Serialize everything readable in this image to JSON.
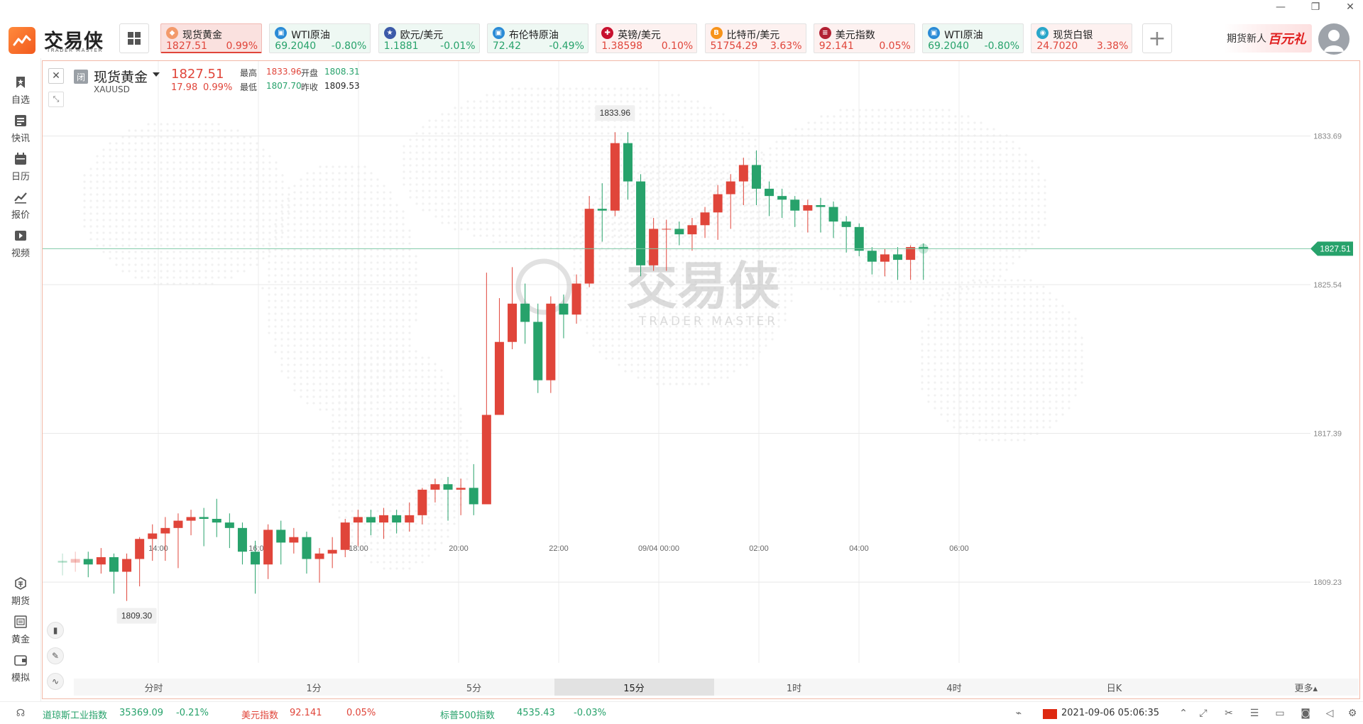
{
  "app": {
    "brand": "交易侠",
    "brand_sub": "TRADER MASTER"
  },
  "window": {
    "minimize": "—",
    "restore": "❐",
    "close": "✕"
  },
  "quotes": [
    {
      "name": "现货黄金",
      "price": "1827.51",
      "pct": "0.99%",
      "dir": "up",
      "icon_color": "#f39a6b",
      "icon_char": "◆",
      "active": true
    },
    {
      "name": "WTI原油",
      "price": "69.2040",
      "pct": "-0.80%",
      "dir": "down",
      "icon_color": "#2a8bd6",
      "icon_char": "▣",
      "active": false
    },
    {
      "name": "欧元/美元",
      "price": "1.1881",
      "pct": "-0.01%",
      "dir": "down",
      "icon_color": "#3c5aa8",
      "icon_char": "★",
      "active": false
    },
    {
      "name": "布伦特原油",
      "price": "72.42",
      "pct": "-0.49%",
      "dir": "down",
      "icon_color": "#2a8bd6",
      "icon_char": "▣",
      "active": false
    },
    {
      "name": "英镑/美元",
      "price": "1.38598",
      "pct": "0.10%",
      "dir": "up",
      "icon_color": "#c8102e",
      "icon_char": "✚",
      "active": false
    },
    {
      "name": "比特币/美元",
      "price": "51754.29",
      "pct": "3.63%",
      "dir": "up",
      "icon_color": "#f7931a",
      "icon_char": "B",
      "active": false
    },
    {
      "name": "美元指数",
      "price": "92.141",
      "pct": "0.05%",
      "dir": "up",
      "icon_color": "#b22234",
      "icon_char": "≡",
      "active": false
    },
    {
      "name": "WTI原油",
      "price": "69.2040",
      "pct": "-0.80%",
      "dir": "down",
      "icon_color": "#2a8bd6",
      "icon_char": "▣",
      "active": false
    },
    {
      "name": "现货白银",
      "price": "24.7020",
      "pct": "3.38%",
      "dir": "up",
      "icon_color": "#2aa6c9",
      "icon_char": "◉",
      "active": false
    }
  ],
  "add_button": "+",
  "promo": {
    "text": "期货新人",
    "highlight": "百元礼"
  },
  "sidebar": {
    "top": [
      {
        "label": "自选",
        "icon": "bookmark-icon"
      },
      {
        "label": "快讯",
        "icon": "newsflash-icon"
      },
      {
        "label": "日历",
        "icon": "calendar-icon"
      },
      {
        "label": "报价",
        "icon": "quote-chart-icon"
      },
      {
        "label": "视频",
        "icon": "video-icon"
      }
    ],
    "bottom": [
      {
        "label": "期货",
        "icon": "futures-icon"
      },
      {
        "label": "黄金",
        "icon": "gold-icon"
      },
      {
        "label": "模拟",
        "icon": "simulation-icon"
      }
    ]
  },
  "symbol": {
    "status": "闭",
    "name": "现货黄金",
    "code": "XAUUSD",
    "price": "1827.51",
    "change": "17.98",
    "pct": "0.99%",
    "high_label": "最高",
    "high": "1833.96",
    "low_label": "最低",
    "low": "1807.70",
    "open_label": "开盘",
    "open": "1808.31",
    "prev_label": "昨收",
    "prev": "1809.53"
  },
  "watermark": {
    "text": "交易侠",
    "sub": "TRADER MASTER"
  },
  "periods": [
    "分时",
    "1分",
    "5分",
    "15分",
    "1时",
    "4时",
    "日K"
  ],
  "active_period": "15分",
  "more_periods": "更多▴",
  "statusbar": {
    "tickers": [
      {
        "name": "道琼斯工业指数",
        "value": "35369.09",
        "pct": "-0.21%",
        "dir": "down"
      },
      {
        "name": "美元指数",
        "value": "92.141",
        "pct": "0.05%",
        "dir": "up"
      },
      {
        "name": "标普500指数",
        "value": "4535.43",
        "pct": "-0.03%",
        "dir": "down"
      }
    ],
    "datetime": "2021-09-06 05:06:35"
  },
  "colors": {
    "up": "#e0453a",
    "down": "#27a26b",
    "accent": "#f25a1e"
  },
  "chart_data": {
    "type": "candlestick",
    "ylim": [
      1804.8,
      1837.8
    ],
    "y_ticks": [
      {
        "value": 1833.69,
        "label": "1833.69"
      },
      {
        "value": 1825.54,
        "label": "1825.54"
      },
      {
        "value": 1817.39,
        "label": "1817.39"
      },
      {
        "value": 1809.23,
        "label": "1809.23"
      }
    ],
    "x_ticks": [
      "14:00",
      "16:00",
      "18:00",
      "20:00",
      "22:00",
      "09/04 00:00",
      "02:00",
      "04:00",
      "06:00"
    ],
    "current_price": "1827.51",
    "max_label": "1833.96",
    "min_label": "1809.30",
    "candles": [
      [
        1810.4,
        1810.3,
        1810.8,
        1809.6
      ],
      [
        1810.3,
        1810.5,
        1810.9,
        1809.8
      ],
      [
        1810.5,
        1810.2,
        1810.9,
        1809.5
      ],
      [
        1810.2,
        1810.6,
        1811.1,
        1809.7
      ],
      [
        1810.6,
        1809.8,
        1810.8,
        1808.6
      ],
      [
        1809.8,
        1810.5,
        1810.8,
        1808.2
      ],
      [
        1810.5,
        1811.6,
        1811.7,
        1809.0
      ],
      [
        1811.6,
        1811.9,
        1812.4,
        1810.4
      ],
      [
        1811.9,
        1812.2,
        1812.8,
        1810.4
      ],
      [
        1812.2,
        1812.6,
        1813.0,
        1810.0
      ],
      [
        1812.6,
        1812.8,
        1813.2,
        1811.8
      ],
      [
        1812.8,
        1812.7,
        1813.3,
        1811.2
      ],
      [
        1812.7,
        1812.5,
        1813.8,
        1811.7
      ],
      [
        1812.5,
        1812.2,
        1813.0,
        1811.1
      ],
      [
        1812.2,
        1810.9,
        1812.5,
        1810.2
      ],
      [
        1810.9,
        1810.2,
        1811.5,
        1808.6
      ],
      [
        1810.2,
        1812.1,
        1812.4,
        1809.4
      ],
      [
        1812.1,
        1811.4,
        1812.6,
        1810.2
      ],
      [
        1811.4,
        1811.7,
        1812.2,
        1810.8
      ],
      [
        1811.7,
        1810.5,
        1812.0,
        1809.7
      ],
      [
        1810.5,
        1810.8,
        1811.1,
        1809.2
      ],
      [
        1810.8,
        1811.0,
        1811.7,
        1810.0
      ],
      [
        1811.0,
        1812.5,
        1812.7,
        1810.6
      ],
      [
        1812.5,
        1812.8,
        1813.2,
        1811.2
      ],
      [
        1812.8,
        1812.5,
        1813.2,
        1811.8
      ],
      [
        1812.5,
        1812.9,
        1813.3,
        1811.6
      ],
      [
        1812.9,
        1812.5,
        1813.2,
        1811.9
      ],
      [
        1812.5,
        1812.9,
        1813.6,
        1812.0
      ],
      [
        1812.9,
        1814.3,
        1814.4,
        1812.4
      ],
      [
        1814.3,
        1814.6,
        1814.9,
        1813.6
      ],
      [
        1814.6,
        1814.3,
        1815.0,
        1812.6
      ],
      [
        1814.3,
        1814.4,
        1814.9,
        1812.9
      ],
      [
        1814.4,
        1813.5,
        1815.7,
        1812.9
      ],
      [
        1813.5,
        1818.4,
        1826.2,
        1818.0
      ],
      [
        1818.4,
        1822.4,
        1824.8,
        1818.9
      ],
      [
        1822.4,
        1824.5,
        1826.5,
        1822.0
      ],
      [
        1824.5,
        1823.5,
        1825.6,
        1822.3
      ],
      [
        1823.5,
        1820.3,
        1824.5,
        1819.6
      ],
      [
        1820.3,
        1824.5,
        1824.9,
        1819.6
      ],
      [
        1824.5,
        1823.9,
        1825.0,
        1822.6
      ],
      [
        1823.9,
        1825.6,
        1826.1,
        1823.4
      ],
      [
        1825.6,
        1829.7,
        1830.4,
        1825.4
      ],
      [
        1829.7,
        1829.6,
        1831.1,
        1827.9
      ],
      [
        1829.6,
        1833.3,
        1833.9,
        1829.3
      ],
      [
        1833.3,
        1831.2,
        1833.9,
        1830.2
      ],
      [
        1831.2,
        1826.6,
        1831.6,
        1826.0
      ],
      [
        1826.6,
        1828.6,
        1829.2,
        1826.3
      ],
      [
        1828.6,
        1828.6,
        1829.1,
        1826.3
      ],
      [
        1828.6,
        1828.3,
        1829.0,
        1827.7
      ],
      [
        1828.3,
        1828.8,
        1829.2,
        1827.4
      ],
      [
        1828.8,
        1829.5,
        1829.8,
        1828.1
      ],
      [
        1829.5,
        1830.5,
        1831.0,
        1828.0
      ],
      [
        1830.5,
        1831.2,
        1831.6,
        1828.6
      ],
      [
        1831.2,
        1832.1,
        1832.5,
        1829.9
      ],
      [
        1832.1,
        1830.8,
        1832.9,
        1829.9
      ],
      [
        1830.8,
        1830.4,
        1831.2,
        1829.3
      ],
      [
        1830.4,
        1830.2,
        1830.8,
        1829.2
      ],
      [
        1830.2,
        1829.6,
        1830.4,
        1828.7
      ],
      [
        1829.6,
        1829.9,
        1830.2,
        1828.4
      ],
      [
        1829.9,
        1829.8,
        1830.3,
        1828.4
      ],
      [
        1829.8,
        1829.0,
        1830.1,
        1828.1
      ],
      [
        1829.0,
        1828.7,
        1829.3,
        1827.3
      ],
      [
        1828.7,
        1827.4,
        1828.9,
        1827.1
      ],
      [
        1827.4,
        1826.8,
        1827.6,
        1826.1
      ],
      [
        1826.8,
        1827.2,
        1827.5,
        1826.0
      ],
      [
        1827.2,
        1826.9,
        1827.6,
        1825.8
      ],
      [
        1826.9,
        1827.6,
        1827.7,
        1825.8
      ],
      [
        1827.6,
        1827.5,
        1827.8,
        1825.8
      ]
    ]
  }
}
